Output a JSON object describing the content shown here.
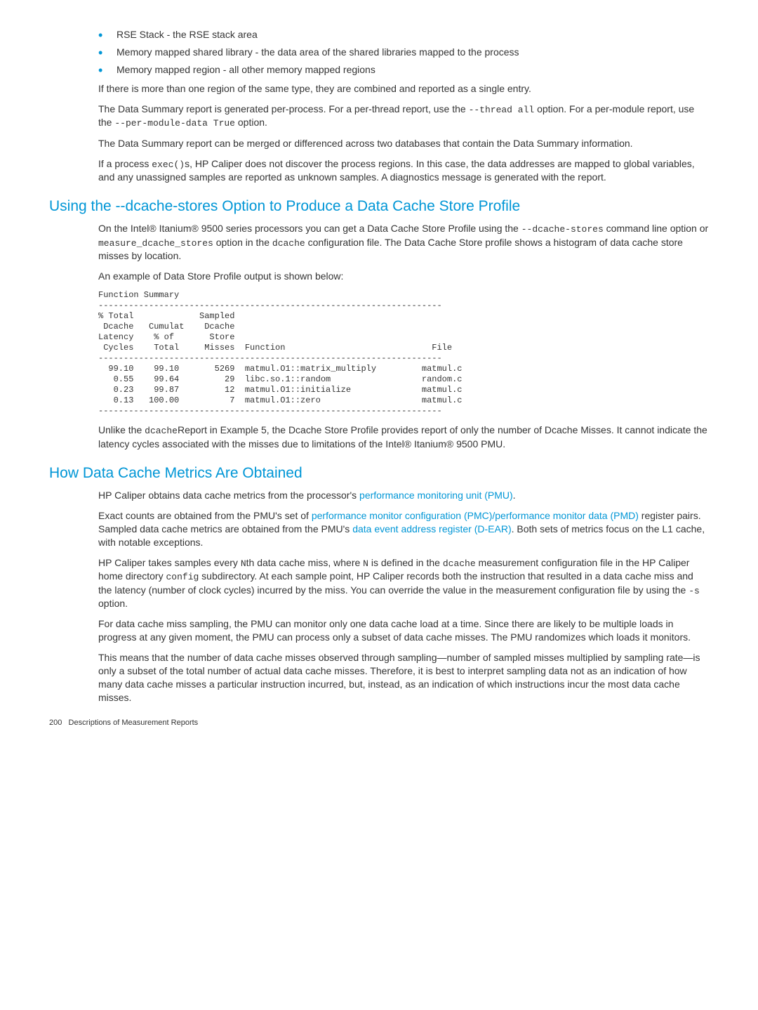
{
  "bullets": [
    {
      "term": "RSE Stack",
      "desc": " - the RSE stack area"
    },
    {
      "term": "Memory mapped shared library",
      "desc": " - the data area of the shared libraries mapped to the process"
    },
    {
      "term": "Memory mapped region",
      "desc": " - all other memory mapped regions"
    }
  ],
  "para1": "If there is more than one region of the same type, they are combined and reported as a single entry.",
  "para2a": "The Data Summary report is generated per-process. For a per-thread report, use the ",
  "para2_code1": "--thread all",
  "para2b": " option. For a per-module report, use the ",
  "para2_code2": "--per-module-data True",
  "para2c": " option.",
  "para3": "The Data Summary report can be merged or differenced across two databases that contain the Data Summary information.",
  "para4a": "If a process ",
  "para4_code1": "exec()",
  "para4b": "s, HP Caliper does not discover the process regions. In this case, the data addresses are mapped to global variables, and any unassigned samples are reported as unknown samples. A diagnostics message is generated with the report.",
  "h2_1": "Using the --dcache-stores Option to Produce a Data Cache Store Profile",
  "s1_p1a": "On the Intel® Itanium® 9500 series processors you can get a Data Cache Store Profile using the ",
  "s1_p1_code1": "--dcache-stores",
  "s1_p1b": " command line option or ",
  "s1_p1_code2": "measure_dcache_stores",
  "s1_p1c": " option in the ",
  "s1_p1_code3": "dcache",
  "s1_p1d": " configuration file. The Data Cache Store profile shows a histogram of data cache store misses by location.",
  "s1_p2": "An example of Data Store Profile output is shown below:",
  "codeblock": "Function Summary\n--------------------------------------------------------------------\n% Total             Sampled\n Dcache   Cumulat    Dcache\nLatency    % of       Store\n Cycles    Total     Misses  Function                             File\n--------------------------------------------------------------------\n  99.10    99.10       5269  matmul.O1::matrix_multiply         matmul.c\n   0.55    99.64         29  libc.so.1::random                  random.c\n   0.23    99.87         12  matmul.O1::initialize              matmul.c\n   0.13   100.00          7  matmul.O1::zero                    matmul.c\n--------------------------------------------------------------------",
  "s1_p3a": "Unlike the ",
  "s1_p3_code1": "dcache",
  "s1_p3b": "Report in Example 5, the Dcache Store Profile provides report of only the number of Dcache Misses. It cannot indicate the latency cycles associated with the misses due to limitations of the Intel® Itanium® 9500 PMU.",
  "h2_2": "How Data Cache Metrics Are Obtained",
  "s2_p1a": "HP Caliper obtains data cache metrics from the processor's ",
  "s2_p1_link1": "performance monitoring unit (PMU)",
  "s2_p1b": ".",
  "s2_p2a": "Exact counts are obtained from the PMU's set of ",
  "s2_p2_link1": "performance monitor configuration (PMC)/performance monitor data (PMD)",
  "s2_p2b": " register pairs. Sampled data cache metrics are obtained from the PMU's ",
  "s2_p2_link2": "data event address register (D-EAR)",
  "s2_p2c": ". Both sets of metrics focus on the L1 cache, with notable exceptions.",
  "s2_p3a": "HP Caliper takes samples every ",
  "s2_p3_code1": "N",
  "s2_p3b": "th data cache miss, where ",
  "s2_p3_code2": "N",
  "s2_p3c": " is defined in the ",
  "s2_p3_code3": "dcache",
  "s2_p3d": " measurement configuration file in the HP Caliper home directory ",
  "s2_p3_code4": "config",
  "s2_p3e": " subdirectory. At each sample point, HP Caliper records both the instruction that resulted in a data cache miss and the latency (number of clock cycles) incurred by the miss. You can override the value in the measurement configuration file by using the ",
  "s2_p3_code5": "-s",
  "s2_p3f": " option.",
  "s2_p4": "For data cache miss sampling, the PMU can monitor only one data cache load at a time. Since there are likely to be multiple loads in progress at any given moment, the PMU can process only a subset of data cache misses. The PMU randomizes which loads it monitors.",
  "s2_p5": "This means that the number of data cache misses observed through sampling—number of sampled misses multiplied by sampling rate—is only a subset of the total number of actual data cache misses. Therefore, it is best to interpret sampling data not as an indication of how many data cache misses a particular instruction incurred, but, instead, as an indication of which instructions incur the most data cache misses.",
  "footer_page": "200",
  "footer_title": "Descriptions of Measurement Reports"
}
